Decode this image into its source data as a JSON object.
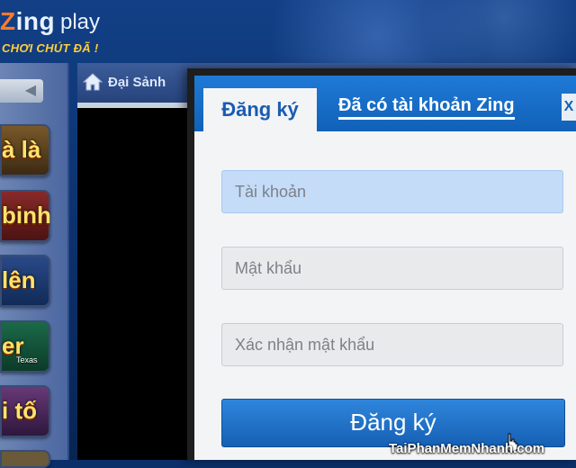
{
  "logo": {
    "brand_z": "Z",
    "brand_rest": "ing",
    "play": "play",
    "slogan": "CHƠI CHÚT ĐÃ !"
  },
  "sidebar": {
    "back_glyph": "◀",
    "games": [
      {
        "label": "à là",
        "sub": ""
      },
      {
        "label": "binh",
        "sub": ""
      },
      {
        "label": "lên",
        "sub": ""
      },
      {
        "label": "er",
        "sub": "Texas"
      },
      {
        "label": "i tố",
        "sub": ""
      }
    ]
  },
  "topnav": {
    "home_label": "Đại Sảnh"
  },
  "modal": {
    "tab_register": "Đăng ký",
    "tab_login": "Đã có tài khoản Zing",
    "close": "X",
    "fields": {
      "username_placeholder": "Tài khoản",
      "password_placeholder": "Mật khẩu",
      "confirm_placeholder": "Xác nhận mật khẩu"
    },
    "submit_label": "Đăng ký"
  },
  "watermark": "TaiPhanMemNhanh.com",
  "colors": {
    "accent": "#1f7ad6",
    "focus_field": "#c4dcf7",
    "logo_z": "#ff7a2a",
    "slogan": "#ffcf3a"
  }
}
